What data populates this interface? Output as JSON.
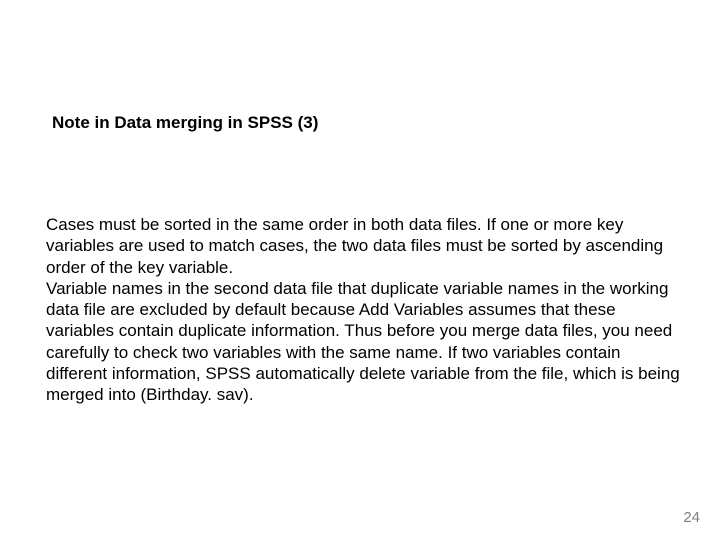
{
  "slide": {
    "title": "Note in Data merging in SPSS (3)",
    "body": "Cases must be sorted in the same order in both data files. If one or more key variables are used to match cases, the two data files must be sorted by ascending order of the key variable.\nVariable names in the second data file that duplicate variable names in the working data file are excluded by default because Add Variables assumes that these variables contain duplicate information. Thus before you merge data files, you need carefully to check two variables with the same name.  If two variables contain different information, SPSS automatically delete variable from the file, which is being merged into (Birthday. sav).",
    "page_number": "24"
  }
}
